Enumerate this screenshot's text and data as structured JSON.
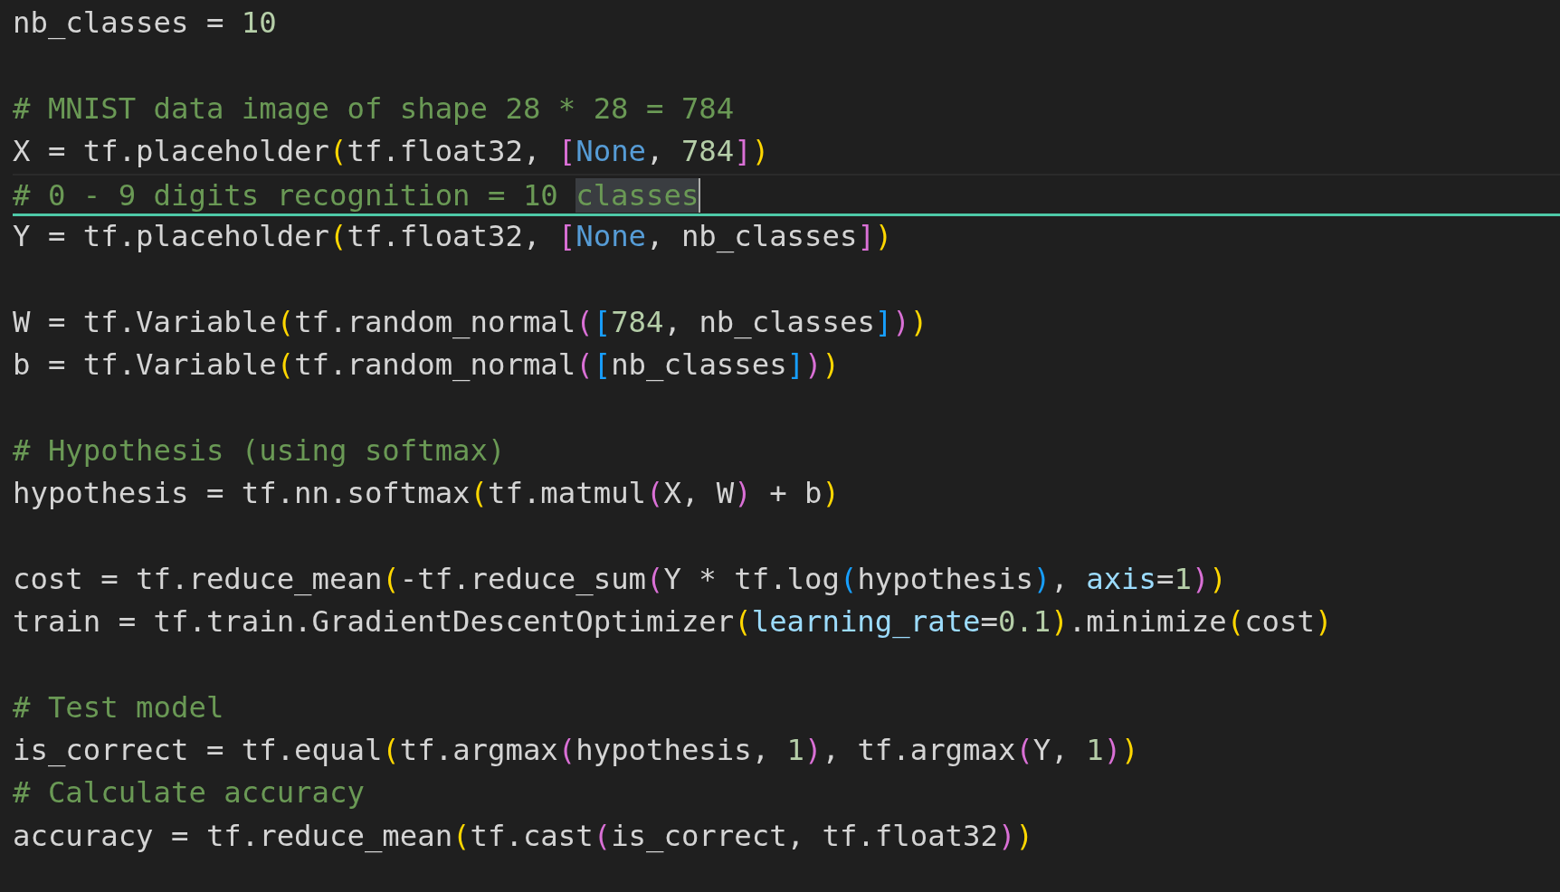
{
  "editor": {
    "lines": [
      {
        "current": false,
        "tokens": [
          {
            "kind": "plain",
            "text": "nb_classes = "
          },
          {
            "kind": "number",
            "text": "10"
          }
        ]
      },
      {
        "current": false
      },
      {
        "current": false,
        "tokens": [
          {
            "kind": "comment",
            "text": "# MNIST data image of shape 28 * 28 = 784"
          }
        ]
      },
      {
        "current": false,
        "tokens": [
          {
            "kind": "plain",
            "text": "X = tf.placeholder"
          },
          {
            "kind": "bracket1",
            "text": "("
          },
          {
            "kind": "plain",
            "text": "tf.float32, "
          },
          {
            "kind": "bracket2",
            "text": "["
          },
          {
            "kind": "constant",
            "text": "None"
          },
          {
            "kind": "plain",
            "text": ", "
          },
          {
            "kind": "number",
            "text": "784"
          },
          {
            "kind": "bracket2",
            "text": "]"
          },
          {
            "kind": "bracket1",
            "text": ")"
          }
        ]
      },
      {
        "current": true,
        "tokens": [
          {
            "kind": "comment",
            "text": "# 0 - 9 digits recognition = 10 "
          },
          {
            "kind": "comment-selected",
            "text": "classes"
          }
        ]
      },
      {
        "current": false,
        "tokens": [
          {
            "kind": "plain",
            "text": "Y = tf.placeholder"
          },
          {
            "kind": "bracket1",
            "text": "("
          },
          {
            "kind": "plain",
            "text": "tf.float32, "
          },
          {
            "kind": "bracket2",
            "text": "["
          },
          {
            "kind": "constant",
            "text": "None"
          },
          {
            "kind": "plain",
            "text": ", nb_classes"
          },
          {
            "kind": "bracket2",
            "text": "]"
          },
          {
            "kind": "bracket1",
            "text": ")"
          }
        ]
      },
      {
        "current": false
      },
      {
        "current": false,
        "tokens": [
          {
            "kind": "plain",
            "text": "W = tf.Variable"
          },
          {
            "kind": "bracket1",
            "text": "("
          },
          {
            "kind": "plain",
            "text": "tf.random_normal"
          },
          {
            "kind": "bracket2",
            "text": "("
          },
          {
            "kind": "bracket3",
            "text": "["
          },
          {
            "kind": "number",
            "text": "784"
          },
          {
            "kind": "plain",
            "text": ", nb_classes"
          },
          {
            "kind": "bracket3",
            "text": "]"
          },
          {
            "kind": "bracket2",
            "text": ")"
          },
          {
            "kind": "bracket1",
            "text": ")"
          }
        ]
      },
      {
        "current": false,
        "tokens": [
          {
            "kind": "plain",
            "text": "b = tf.Variable"
          },
          {
            "kind": "bracket1",
            "text": "("
          },
          {
            "kind": "plain",
            "text": "tf.random_normal"
          },
          {
            "kind": "bracket2",
            "text": "("
          },
          {
            "kind": "bracket3",
            "text": "["
          },
          {
            "kind": "plain",
            "text": "nb_classes"
          },
          {
            "kind": "bracket3",
            "text": "]"
          },
          {
            "kind": "bracket2",
            "text": ")"
          },
          {
            "kind": "bracket1",
            "text": ")"
          }
        ]
      },
      {
        "current": false
      },
      {
        "current": false,
        "tokens": [
          {
            "kind": "comment",
            "text": "# Hypothesis (using softmax)"
          }
        ]
      },
      {
        "current": false,
        "tokens": [
          {
            "kind": "plain",
            "text": "hypothesis = tf.nn.softmax"
          },
          {
            "kind": "bracket1",
            "text": "("
          },
          {
            "kind": "plain",
            "text": "tf.matmul"
          },
          {
            "kind": "bracket2",
            "text": "("
          },
          {
            "kind": "plain",
            "text": "X, W"
          },
          {
            "kind": "bracket2",
            "text": ")"
          },
          {
            "kind": "plain",
            "text": " + b"
          },
          {
            "kind": "bracket1",
            "text": ")"
          }
        ]
      },
      {
        "current": false
      },
      {
        "current": false,
        "tokens": [
          {
            "kind": "plain",
            "text": "cost = tf.reduce_mean"
          },
          {
            "kind": "bracket1",
            "text": "("
          },
          {
            "kind": "plain",
            "text": "-tf.reduce_sum"
          },
          {
            "kind": "bracket2",
            "text": "("
          },
          {
            "kind": "plain",
            "text": "Y * tf.log"
          },
          {
            "kind": "bracket3",
            "text": "("
          },
          {
            "kind": "plain",
            "text": "hypothesis"
          },
          {
            "kind": "bracket3",
            "text": ")"
          },
          {
            "kind": "plain",
            "text": ", "
          },
          {
            "kind": "parameter",
            "text": "axis"
          },
          {
            "kind": "plain",
            "text": "="
          },
          {
            "kind": "number",
            "text": "1"
          },
          {
            "kind": "bracket2",
            "text": ")"
          },
          {
            "kind": "bracket1",
            "text": ")"
          }
        ]
      },
      {
        "current": false,
        "tokens": [
          {
            "kind": "plain",
            "text": "train = tf.train.GradientDescentOptimizer"
          },
          {
            "kind": "bracket1",
            "text": "("
          },
          {
            "kind": "parameter",
            "text": "learning_rate"
          },
          {
            "kind": "plain",
            "text": "="
          },
          {
            "kind": "number",
            "text": "0.1"
          },
          {
            "kind": "bracket1",
            "text": ")"
          },
          {
            "kind": "plain",
            "text": ".minimize"
          },
          {
            "kind": "bracket1",
            "text": "("
          },
          {
            "kind": "plain",
            "text": "cost"
          },
          {
            "kind": "bracket1",
            "text": ")"
          }
        ]
      },
      {
        "current": false
      },
      {
        "current": false,
        "tokens": [
          {
            "kind": "comment",
            "text": "# Test model"
          }
        ]
      },
      {
        "current": false,
        "tokens": [
          {
            "kind": "plain",
            "text": "is_correct = tf.equal"
          },
          {
            "kind": "bracket1",
            "text": "("
          },
          {
            "kind": "plain",
            "text": "tf.argmax"
          },
          {
            "kind": "bracket2",
            "text": "("
          },
          {
            "kind": "plain",
            "text": "hypothesis, "
          },
          {
            "kind": "number",
            "text": "1"
          },
          {
            "kind": "bracket2",
            "text": ")"
          },
          {
            "kind": "plain",
            "text": ", tf.argmax"
          },
          {
            "kind": "bracket2",
            "text": "("
          },
          {
            "kind": "plain",
            "text": "Y, "
          },
          {
            "kind": "number",
            "text": "1"
          },
          {
            "kind": "bracket2",
            "text": ")"
          },
          {
            "kind": "bracket1",
            "text": ")"
          }
        ]
      },
      {
        "current": false,
        "tokens": [
          {
            "kind": "comment",
            "text": "# Calculate accuracy"
          }
        ]
      },
      {
        "current": false,
        "tokens": [
          {
            "kind": "plain",
            "text": "accuracy = tf.reduce_mean"
          },
          {
            "kind": "bracket1",
            "text": "("
          },
          {
            "kind": "plain",
            "text": "tf.cast"
          },
          {
            "kind": "bracket2",
            "text": "("
          },
          {
            "kind": "plain",
            "text": "is_correct, tf.float32"
          },
          {
            "kind": "bracket2",
            "text": ")"
          },
          {
            "kind": "bracket1",
            "text": ")"
          }
        ]
      }
    ]
  }
}
